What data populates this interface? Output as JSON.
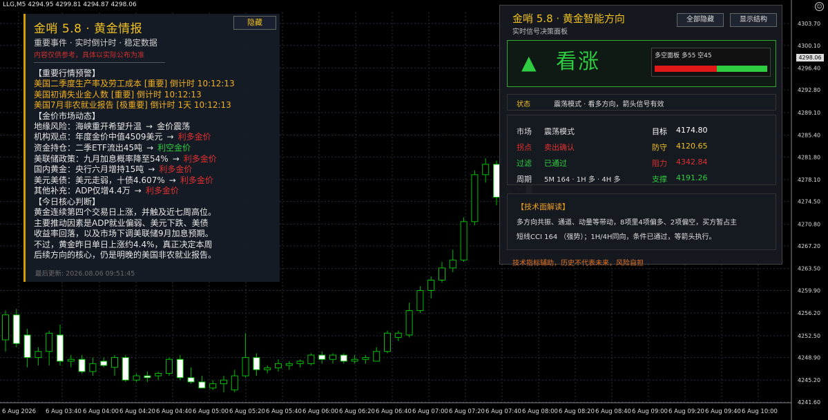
{
  "ohlc_header": "LLG,M5  4294.95 4299.81 4294.87 4298.06",
  "left_panel": {
    "title": "金哨 5.8 · 黄金情报",
    "subtitle": "重要事件 · 实时倒计时 · 稳定数据",
    "disclaimer": "内容仅供参考，具体以实际公布为准",
    "hide_label": "隐藏",
    "alerts_header": "【重要行情预警】",
    "alerts": [
      "美国二季度生产率及劳工成本 [重要] 倒计时 10:12:13",
      "美国初请失业金人数 [重要] 倒计时 10:12:13",
      "美国7月非农就业报告 [极重要] 倒计时 1天 10:12:13"
    ],
    "market_header": "【金价市场动态】",
    "market": [
      {
        "text": "地缘风险：海峡重开希望升温",
        "arrow": "→",
        "result": "金价震荡",
        "color": "white"
      },
      {
        "text": "机构观点：年度金价中值4509美元",
        "arrow": "→",
        "result": "利多金价",
        "color": "red"
      },
      {
        "text": "资金持仓：二季ETF流出45吨",
        "arrow": "→",
        "result": "利空金价",
        "color": "green"
      },
      {
        "text": "美联储政策：九月加息概率降至54%",
        "arrow": "→",
        "result": "利多金价",
        "color": "red"
      },
      {
        "text": "国内黄金：央行六月增持15吨",
        "arrow": "→",
        "result": "利多金价",
        "color": "red"
      },
      {
        "text": "美元美债：美元走弱，十债4.607%",
        "arrow": "→",
        "result": "利多金价",
        "color": "red"
      },
      {
        "text": "其他补充：ADP仅增4.4万",
        "arrow": "→",
        "result": "利多金价",
        "color": "red"
      }
    ],
    "judgment_header": "【今日核心判断】",
    "judgment": [
      "黄金连续第四个交易日上涨，并触及近七周高位。",
      "主要推动因素是ADP就业偏弱、美元下跌、美债",
      "收益率回落，以及市场下调美联储9月加息预期。",
      "不过，黄金昨日单日上涨约4.4%，真正决定本周",
      "后续方向的核心，仍是明晚的美国非农就业报告。"
    ],
    "updated": "最后更新: 2026.08.06 09:51:45"
  },
  "right_panel": {
    "title": "金哨 5.8 · 黄金智能方向",
    "subtitle": "实时信号决策面板",
    "hide_all_label": "全部隐藏",
    "show_structure_label": "显示结构",
    "signal_arrow": "▲",
    "signal_text": "看涨",
    "mini_panel_label": "多空面板  多55  空45",
    "bull_pct": 55,
    "bear_pct": 45,
    "status_label": "状态",
    "status_text": "震荡模式 · 看多方向，箭头信号有效",
    "rows": [
      {
        "k1": "市场",
        "v1": "震荡模式",
        "k2": "目标",
        "v2": "4174.80"
      },
      {
        "k1": "拐点",
        "v1": "卖出确认",
        "k2": "防守",
        "v2": "4120.65"
      },
      {
        "k1": "过滤",
        "v1": "已通过",
        "k2": "阻力",
        "v2": "4342.84"
      },
      {
        "k1": "周期",
        "v1": "5M 164 · 1H 多 · 4H 多",
        "k2": "支撑",
        "v2": "4191.26"
      }
    ],
    "tech_header": "【技术面解读】",
    "tech_lines": [
      "多方向共振、通道、动量等带动，8项里4项偏多、2项偏空，买方暂占主",
      "短线CCI 164 （强势）；1H/4H同向，条件已通过，等箭头执行。"
    ],
    "footer": "技术指标辅助，历史不代表未来，风险自担"
  },
  "price_axis": [
    "4303.70",
    "4300.10",
    "4296.40",
    "4292.80",
    "4289.10",
    "4285.40",
    "4281.80",
    "4278.10",
    "4274.50",
    "4270.80",
    "4267.20",
    "4263.50",
    "4259.90",
    "4256.20",
    "4252.50",
    "4248.90",
    "4245.20",
    "4241.60"
  ],
  "current_price": "4298.06",
  "time_axis": [
    "6 Aug 2026",
    "6 Aug 03:40",
    "6 Aug 04:00",
    "6 Aug 04:20",
    "6 Aug 04:40",
    "6 Aug 05:00",
    "6 Aug 05:20",
    "6 Aug 05:40",
    "6 Aug 06:00",
    "6 Aug 06:20",
    "6 Aug 06:40",
    "6 Aug 07:00",
    "6 Aug 07:20",
    "6 Aug 07:40",
    "6 Aug 08:00",
    "6 Aug 08:20",
    "6 Aug 08:40",
    "6 Aug 09:00",
    "6 Aug 09:20",
    "6 Aug 09:40",
    "6 Aug 10:00"
  ],
  "candles": [
    {
      "o": 4251.8,
      "h": 4256.6,
      "l": 4249.9,
      "c": 4255.9
    },
    {
      "o": 4255.9,
      "h": 4256.9,
      "l": 4250.6,
      "c": 4251.2
    },
    {
      "o": 4252.6,
      "h": 4253.6,
      "l": 4247.3,
      "c": 4248.9
    },
    {
      "o": 4248.9,
      "h": 4250.6,
      "l": 4247.6,
      "c": 4249.9
    },
    {
      "o": 4249.9,
      "h": 4253.3,
      "l": 4247.6,
      "c": 4252.9
    },
    {
      "o": 4252.6,
      "h": 4254.3,
      "l": 4247.6,
      "c": 4248.3
    },
    {
      "o": 4248.3,
      "h": 4249.3,
      "l": 4247.3,
      "c": 4248.6
    },
    {
      "o": 4248.6,
      "h": 4249.3,
      "l": 4246.3,
      "c": 4246.6
    },
    {
      "o": 4246.6,
      "h": 4248.9,
      "l": 4245.9,
      "c": 4247.9
    },
    {
      "o": 4248.3,
      "h": 4248.9,
      "l": 4247.3,
      "c": 4247.6
    },
    {
      "o": 4247.3,
      "h": 4249.3,
      "l": 4245.9,
      "c": 4248.9
    },
    {
      "o": 4248.9,
      "h": 4249.3,
      "l": 4244.9,
      "c": 4245.2
    },
    {
      "o": 4245.2,
      "h": 4246.3,
      "l": 4244.9,
      "c": 4245.9
    },
    {
      "o": 4245.9,
      "h": 4246.6,
      "l": 4244.9,
      "c": 4245.6
    },
    {
      "o": 4245.9,
      "h": 4246.6,
      "l": 4245.2,
      "c": 4246.3
    },
    {
      "o": 4246.3,
      "h": 4248.9,
      "l": 4245.9,
      "c": 4248.6
    },
    {
      "o": 4248.6,
      "h": 4249.3,
      "l": 4245.2,
      "c": 4245.6
    },
    {
      "o": 4245.6,
      "h": 4247.3,
      "l": 4244.6,
      "c": 4244.9
    },
    {
      "o": 4244.9,
      "h": 4245.9,
      "l": 4243.9,
      "c": 4243.9
    },
    {
      "o": 4243.9,
      "h": 4245.2,
      "l": 4243.6,
      "c": 4244.6
    },
    {
      "o": 4244.6,
      "h": 4245.9,
      "l": 4243.2,
      "c": 4245.2
    },
    {
      "o": 4243.6,
      "h": 4246.9,
      "l": 4243.2,
      "c": 4245.9
    },
    {
      "o": 4245.9,
      "h": 4252.9,
      "l": 4245.6,
      "c": 4248.9
    },
    {
      "o": 4248.9,
      "h": 4249.6,
      "l": 4245.9,
      "c": 4246.9
    },
    {
      "o": 4246.9,
      "h": 4247.6,
      "l": 4246.3,
      "c": 4247.2
    },
    {
      "o": 4247.2,
      "h": 4248.6,
      "l": 4246.6,
      "c": 4247.9
    },
    {
      "o": 4247.6,
      "h": 4248.3,
      "l": 4246.9,
      "c": 4247.9
    },
    {
      "o": 4247.9,
      "h": 4248.6,
      "l": 4247.3,
      "c": 4248.3
    },
    {
      "o": 4247.9,
      "h": 4249.6,
      "l": 4247.6,
      "c": 4249.3
    },
    {
      "o": 4249.3,
      "h": 4249.9,
      "l": 4247.9,
      "c": 4248.6
    },
    {
      "o": 4248.6,
      "h": 4249.6,
      "l": 4247.9,
      "c": 4249.3
    },
    {
      "o": 4249.3,
      "h": 4249.6,
      "l": 4247.9,
      "c": 4248.3
    },
    {
      "o": 4248.3,
      "h": 4249.3,
      "l": 4247.9,
      "c": 4248.6
    },
    {
      "o": 4248.6,
      "h": 4249.3,
      "l": 4247.9,
      "c": 4248.9
    },
    {
      "o": 4248.3,
      "h": 4250.6,
      "l": 4248.3,
      "c": 4249.9
    },
    {
      "o": 4249.9,
      "h": 4253.3,
      "l": 4249.6,
      "c": 4252.9
    },
    {
      "o": 4252.2,
      "h": 4253.3,
      "l": 4251.6,
      "c": 4252.9
    },
    {
      "o": 4252.6,
      "h": 4257.9,
      "l": 4252.2,
      "c": 4256.6
    },
    {
      "o": 4256.6,
      "h": 4260.6,
      "l": 4256.2,
      "c": 4259.9
    },
    {
      "o": 4259.9,
      "h": 4262.2,
      "l": 4258.6,
      "c": 4261.6
    },
    {
      "o": 4261.6,
      "h": 4264.6,
      "l": 4261.2,
      "c": 4263.6
    },
    {
      "o": 4263.6,
      "h": 4266.6,
      "l": 4262.9,
      "c": 4264.9
    },
    {
      "o": 4264.9,
      "h": 4271.9,
      "l": 4264.6,
      "c": 4271.2
    },
    {
      "o": 4271.2,
      "h": 4279.6,
      "l": 4270.6,
      "c": 4278.9
    },
    {
      "o": 4278.9,
      "h": 4281.6,
      "l": 4277.6,
      "c": 4280.6
    },
    {
      "o": 4280.6,
      "h": 4281.2,
      "l": 4273.9,
      "c": 4275.2
    },
    {
      "o": 4275.2,
      "h": 4277.6,
      "l": 4274.6,
      "c": 4276.2
    },
    {
      "o": 4276.6,
      "h": 4278.9,
      "l": 4275.6,
      "c": 4278.2
    },
    {
      "o": 4278.2,
      "h": 4278.6,
      "l": 4270.6,
      "c": 4271.6
    },
    {
      "o": 4271.6,
      "h": 4274.6,
      "l": 4269.9,
      "c": 4273.6
    },
    {
      "o": 4271.2,
      "h": 4272.9,
      "l": 4269.9,
      "c": 4271.9
    }
  ],
  "colors": {
    "bull": "#00c000",
    "bear_body": "#ffffff",
    "grid": "#24303a",
    "accent": "#f0c020"
  }
}
